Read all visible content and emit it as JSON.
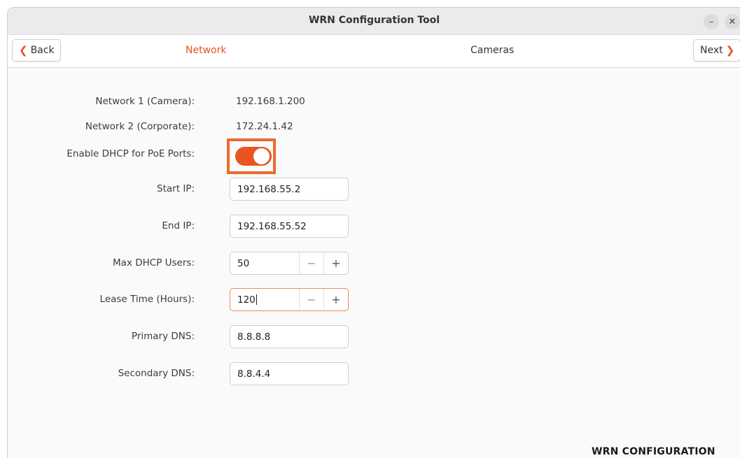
{
  "window": {
    "title": "WRN Configuration Tool",
    "minimize_glyph": "–",
    "close_glyph": "✕"
  },
  "nav": {
    "back_label": "Back",
    "next_label": "Next",
    "back_icon": "chevron-left-icon",
    "next_icon": "chevron-right-icon",
    "tabs": [
      {
        "label": "Network",
        "active": true
      },
      {
        "label": "Cameras",
        "active": false
      }
    ]
  },
  "form": {
    "network1": {
      "label": "Network 1 (Camera):",
      "value": "192.168.1.200"
    },
    "network2": {
      "label": "Network 2 (Corporate):",
      "value": "172.24.1.42"
    },
    "dhcp_toggle": {
      "label": "Enable DHCP for PoE Ports:",
      "on": true
    },
    "start_ip": {
      "label": "Start IP:",
      "value": "192.168.55.2"
    },
    "end_ip": {
      "label": "End IP:",
      "value": "192.168.55.52"
    },
    "max_users": {
      "label": "Max DHCP Users:",
      "value": "50"
    },
    "lease_time": {
      "label": "Lease Time (Hours):",
      "value": "120"
    },
    "primary_dns": {
      "label": "Primary DNS:",
      "value": "8.8.8.8"
    },
    "secondary_dns": {
      "label": "Secondary DNS:",
      "value": "8.8.4.4"
    },
    "stepper_minus": "−",
    "stepper_plus": "+"
  },
  "brand": {
    "text": "WRN CONFIGURATION TOOL"
  },
  "colors": {
    "accent": "#e95420",
    "highlight": "#ec6b2c"
  }
}
